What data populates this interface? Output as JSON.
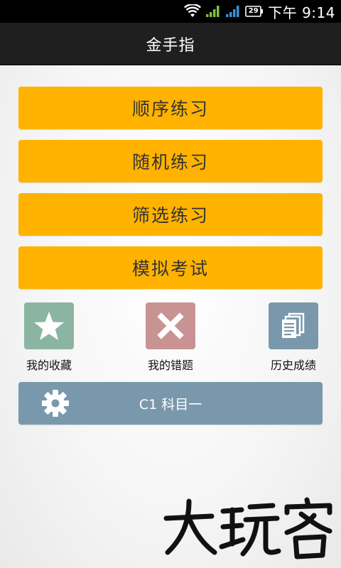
{
  "status_bar": {
    "battery": "29",
    "time": "下午 9:14"
  },
  "app": {
    "title": "金手指"
  },
  "menu": [
    {
      "label": "顺序练习"
    },
    {
      "label": "随机练习"
    },
    {
      "label": "筛选练习"
    },
    {
      "label": "模拟考试"
    }
  ],
  "shortcuts": [
    {
      "label": "我的收藏",
      "icon": "star-icon",
      "color": "#8bb4a3"
    },
    {
      "label": "我的错题",
      "icon": "close-icon",
      "color": "#c99393"
    },
    {
      "label": "历史成绩",
      "icon": "documents-icon",
      "color": "#7a98ab"
    }
  ],
  "subject": {
    "label": "C1 科目一",
    "icon": "gear-icon"
  },
  "watermark": {
    "text": "大玩客"
  },
  "colors": {
    "menu_button": "#ffb300",
    "title_bar": "#1f1f1f",
    "subject_bar": "#7a98ab",
    "signal": "#7fbf3f"
  }
}
